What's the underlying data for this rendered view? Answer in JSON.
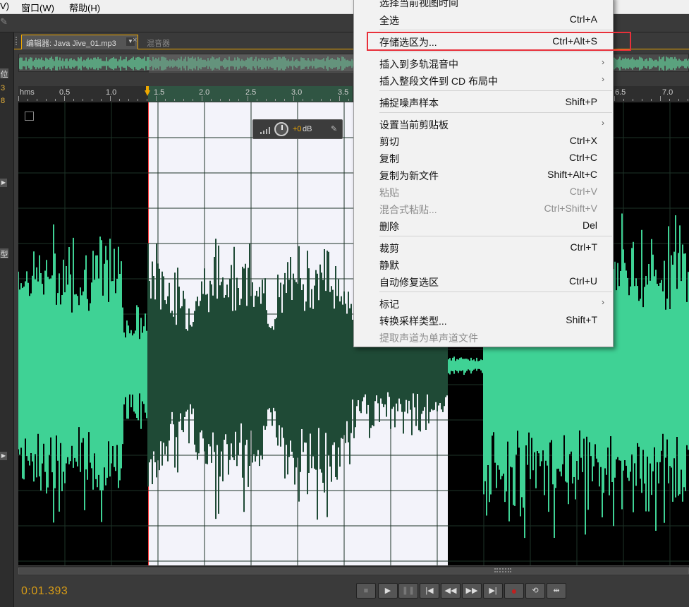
{
  "menubar": {
    "items": [
      "V)",
      "窗口(W)",
      "帮助(H)"
    ]
  },
  "left_dock": {
    "labels": [
      "位",
      "3",
      "8",
      "型"
    ]
  },
  "editor": {
    "tab_label": "编辑器: Java Jive_01.mp3",
    "tab_close": "×",
    "tab_mixer": "混音器"
  },
  "ruler": {
    "labels": [
      "hms",
      "0.5",
      "1.0",
      "1.5",
      "2.0",
      "2.5",
      "3.0",
      "3.5",
      "6.5",
      "7.0"
    ]
  },
  "hud": {
    "value": "+0",
    "unit": "dB"
  },
  "timecode": "0:01.393",
  "transport": [
    "stop",
    "play",
    "pause",
    "go-to-start",
    "rewind",
    "fast-forward",
    "go-to-end",
    "record",
    "loop",
    "skip-selection"
  ],
  "context_menu": {
    "items": [
      {
        "label": "选择当前视图时间",
        "shortcut": ""
      },
      {
        "label": "全选",
        "shortcut": "Ctrl+A"
      },
      {
        "label": "存储选区为...",
        "shortcut": "Ctrl+Alt+S"
      },
      {
        "label": "插入到多轨混音中",
        "shortcut": "",
        "submenu": true
      },
      {
        "label": "插入整段文件到 CD 布局中",
        "shortcut": "",
        "submenu": true
      },
      {
        "label": "捕捉噪声样本",
        "shortcut": "Shift+P"
      },
      {
        "label": "设置当前剪贴板",
        "shortcut": "",
        "submenu": true
      },
      {
        "label": "剪切",
        "shortcut": "Ctrl+X"
      },
      {
        "label": "复制",
        "shortcut": "Ctrl+C"
      },
      {
        "label": "复制为新文件",
        "shortcut": "Shift+Alt+C"
      },
      {
        "label": "粘贴",
        "shortcut": "Ctrl+V",
        "disabled": true
      },
      {
        "label": "混合式粘贴...",
        "shortcut": "Ctrl+Shift+V",
        "disabled": true
      },
      {
        "label": "删除",
        "shortcut": "Del"
      },
      {
        "label": "裁剪",
        "shortcut": "Ctrl+T"
      },
      {
        "label": "静默",
        "shortcut": ""
      },
      {
        "label": "自动修复选区",
        "shortcut": "Ctrl+U"
      },
      {
        "label": "标记",
        "shortcut": "",
        "submenu": true
      },
      {
        "label": "转换采样类型...",
        "shortcut": "Shift+T"
      },
      {
        "label": "提取声道为单声道文件",
        "shortcut": "",
        "disabled": true
      }
    ],
    "highlighted": "存储选区为..."
  },
  "colors": {
    "waveform": "#3fd295",
    "waveform_selected": "#1f4a36",
    "selection_bg": "#f3f3fa",
    "accent": "#f0a800",
    "highlight_box": "#e8303a"
  }
}
